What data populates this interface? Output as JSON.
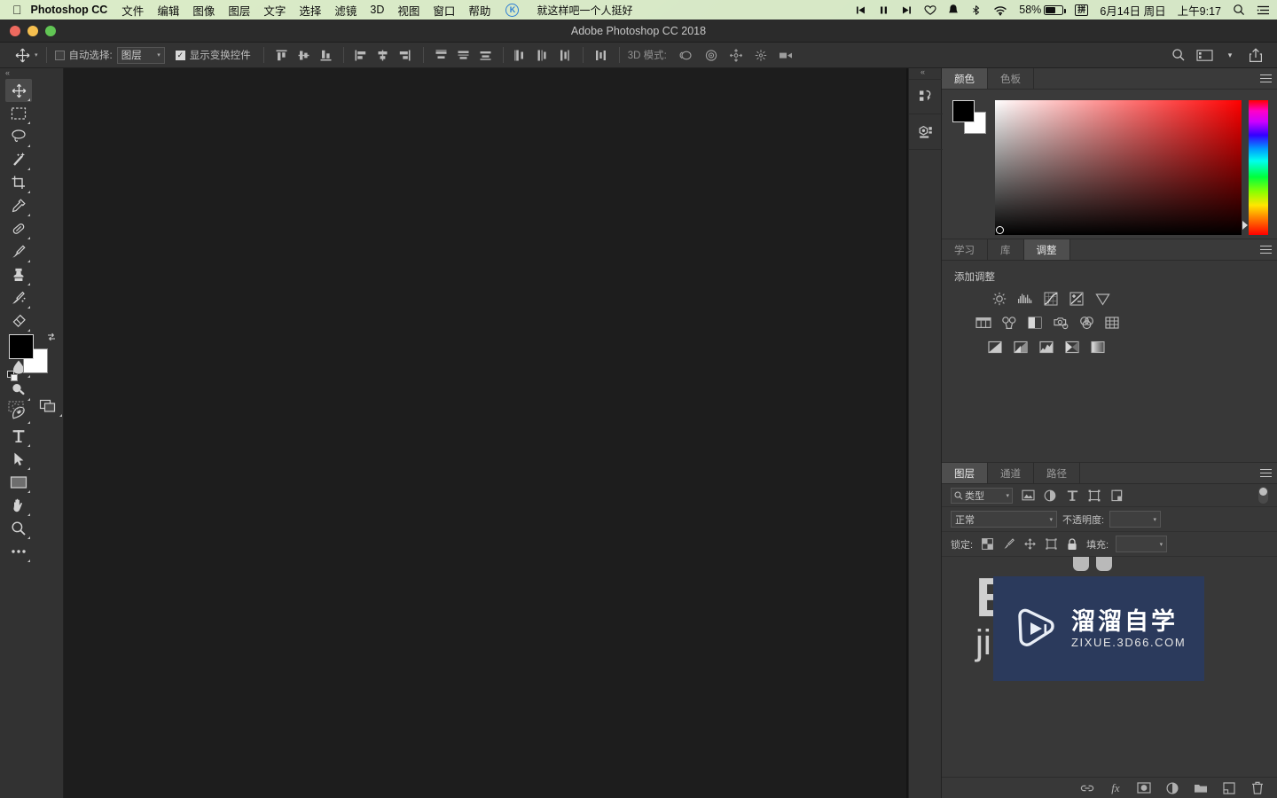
{
  "menubar": {
    "apple_icon": "apple-icon",
    "app_name": "Photoshop CC",
    "menus": [
      "文件",
      "编辑",
      "图像",
      "图层",
      "文字",
      "选择",
      "滤镜",
      "3D",
      "视图",
      "窗口",
      "帮助"
    ],
    "k_badge": "K",
    "now_playing": "就这样吧一个人挺好",
    "media_prev": "⏮",
    "media_pause": "⏸",
    "media_next": "⏭",
    "heart_icon": "heart-icon",
    "bell_icon": "bell-icon",
    "bluetooth_icon": "bluetooth-icon",
    "wifi_icon": "wifi-icon",
    "battery_percent": "58%",
    "input_method": "拼",
    "date": "6月14日 周日",
    "time": "上午9:17",
    "search_icon": "spotlight-search-icon",
    "control_center_icon": "notification-center-icon"
  },
  "window": {
    "title": "Adobe Photoshop CC 2018",
    "close_label": "close",
    "minimize_label": "minimize",
    "zoom_label": "zoom"
  },
  "options_bar": {
    "move_tool_icon": "move-tool-icon",
    "auto_select_label": "自动选择:",
    "auto_select_checked": false,
    "auto_select_value": "图层",
    "show_transform_label": "显示变换控件",
    "show_transform_checked": true,
    "align_group_1": [
      "align-top-edges-icon",
      "align-vertical-centers-icon",
      "align-bottom-edges-icon",
      "align-left-edges-icon",
      "align-horizontal-centers-icon",
      "align-right-edges-icon"
    ],
    "distribute_group": [
      "distribute-top-edges-icon",
      "distribute-vertical-centers-icon",
      "distribute-bottom-edges-icon",
      "distribute-left-edges-icon",
      "distribute-horizontal-centers-icon",
      "distribute-right-edges-icon"
    ],
    "align_extra_icon": "align-distribute-spacing-icon",
    "mode_3d_label": "3D 模式:",
    "mode_3d_icons": [
      "rotate-3d-object-icon",
      "roll-3d-object-icon",
      "pan-3d-object-icon",
      "slide-3d-object-icon",
      "scale-3d-object-icon"
    ],
    "right_icons": [
      "search-icon",
      "workspace-icon",
      "chevron-down-icon",
      "share-icon"
    ]
  },
  "toolbar": {
    "collapse_icon": "collapse-panel-icon",
    "tools": [
      {
        "name": "move-tool",
        "active": true
      },
      {
        "name": "rectangular-marquee-tool",
        "active": false
      },
      {
        "name": "lasso-tool",
        "active": false
      },
      {
        "name": "magic-wand-tool",
        "active": false
      },
      {
        "name": "crop-tool",
        "active": false
      },
      {
        "name": "eyedropper-tool",
        "active": false
      },
      {
        "name": "spot-healing-brush-tool",
        "active": false
      },
      {
        "name": "brush-tool",
        "active": false
      },
      {
        "name": "clone-stamp-tool",
        "active": false
      },
      {
        "name": "history-brush-tool",
        "active": false
      },
      {
        "name": "eraser-tool",
        "active": false
      },
      {
        "name": "gradient-tool",
        "active": false
      },
      {
        "name": "blur-tool",
        "active": false
      },
      {
        "name": "dodge-tool",
        "active": false
      },
      {
        "name": "pen-tool",
        "active": false
      },
      {
        "name": "horizontal-type-tool",
        "active": false
      },
      {
        "name": "path-selection-tool",
        "active": false
      },
      {
        "name": "rectangle-tool",
        "active": false
      },
      {
        "name": "hand-tool",
        "active": false
      },
      {
        "name": "zoom-tool",
        "active": false
      },
      {
        "name": "edit-toolbar-tool",
        "active": false
      }
    ],
    "foreground_color": "#000000",
    "background_color": "#ffffff",
    "swap_colors_icon": "swap-colors-icon",
    "default_colors_icon": "default-colors-icon",
    "quick_mask_icon": "quick-mask-mode-icon",
    "screen_mode_icon": "screen-mode-icon"
  },
  "dock_rail": {
    "collapse_icon": "collapse-dock-icon",
    "buttons": [
      "history-panel-icon",
      "properties-panel-icon"
    ]
  },
  "color_panel": {
    "tabs": [
      {
        "label": "颜色",
        "active": true
      },
      {
        "label": "色板",
        "active": false
      }
    ],
    "menu_icon": "panel-menu-icon",
    "foreground_color": "#000000",
    "background_color": "#ffffff",
    "selected_hue": "#ff0000"
  },
  "adjustments_panel": {
    "tabs": [
      {
        "label": "学习",
        "active": false
      },
      {
        "label": "库",
        "active": false
      },
      {
        "label": "调整",
        "active": true
      }
    ],
    "menu_icon": "panel-menu-icon",
    "title": "添加调整",
    "row1": [
      "brightness-contrast-icon",
      "levels-icon",
      "curves-icon",
      "exposure-icon",
      "vibrance-icon"
    ],
    "row2": [
      "hue-saturation-icon",
      "color-balance-icon",
      "black-white-icon",
      "photo-filter-icon",
      "channel-mixer-icon",
      "color-lookup-icon"
    ],
    "row3": [
      "invert-icon",
      "posterize-icon",
      "threshold-icon",
      "gradient-map-icon",
      "selective-color-icon"
    ]
  },
  "layers_panel": {
    "tabs": [
      {
        "label": "图层",
        "active": true
      },
      {
        "label": "通道",
        "active": false
      },
      {
        "label": "路径",
        "active": false
      }
    ],
    "menu_icon": "panel-menu-icon",
    "filter_kind_label": "类型",
    "filter_search_icon": "search-icon",
    "filter_icons": [
      "filter-pixel-icon",
      "filter-adjustment-icon",
      "filter-type-icon",
      "filter-shape-icon",
      "filter-smart-object-icon"
    ],
    "filter_toggle_icon": "filter-enable-toggle",
    "blend_mode": "正常",
    "opacity_label": "不透明度:",
    "opacity_value": "",
    "lock_label": "锁定:",
    "lock_icons": [
      "lock-transparent-pixels-icon",
      "lock-image-pixels-icon",
      "lock-position-icon",
      "lock-artboard-nesting-icon",
      "lock-all-icon"
    ],
    "fill_label": "填充:",
    "fill_value": "",
    "bottom_icons": [
      "link-layers-icon",
      "layer-style-fx-icon",
      "add-layer-mask-icon",
      "new-adjustment-layer-icon",
      "new-group-icon",
      "new-layer-icon",
      "delete-layer-icon"
    ]
  },
  "watermark": {
    "logo_icon": "play-triangle-logo-icon",
    "brand_cn": "溜溜自学",
    "brand_url": "ZIXUE.3D66.COM",
    "background_color": "#2b3a5c"
  },
  "background_text": {
    "big": "E",
    "sub": "ji"
  },
  "colors": {
    "app_chrome": "#323232",
    "panel_bg": "#383838",
    "canvas_bg": "#1d1d1d",
    "accent_red": "#ff0000",
    "desktop_green": "#4c8c2b"
  }
}
